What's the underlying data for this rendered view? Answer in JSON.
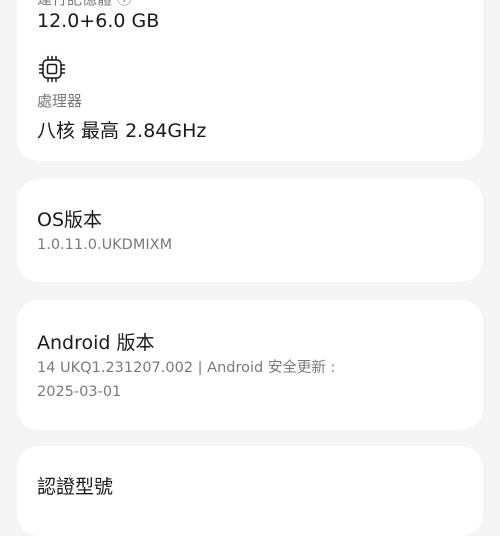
{
  "specs": {
    "memory_label": "運行記憶體 ⓘ",
    "memory_value": "12.0+6.0 GB",
    "processor_icon": "cpu-chip-icon",
    "processor_label": "處理器",
    "processor_value": "八核 最高 2.84GHz"
  },
  "os": {
    "title": "OS版本",
    "value": "1.0.11.0.UKDMIXM"
  },
  "android": {
    "title": "Android 版本",
    "value_line1": "14 UKQ1.231207.002 | Android 安全更新 :",
    "value_line2": "2025-03-01"
  },
  "certification": {
    "title": "認證型號"
  }
}
